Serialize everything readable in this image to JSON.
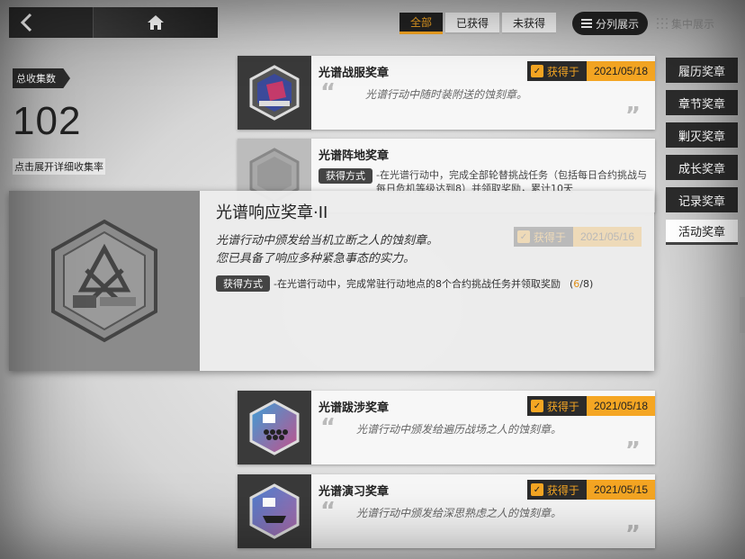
{
  "topbar": {
    "back": "‹",
    "home": "⌂"
  },
  "filters": [
    {
      "label": "全部",
      "active": true
    },
    {
      "label": "已获得",
      "active": false
    },
    {
      "label": "未获得",
      "active": false
    }
  ],
  "view": {
    "list_label": "分列展示",
    "focus_label": "集中展示"
  },
  "collection": {
    "tag": "总收集数",
    "count": "102",
    "hint": "点击展开详细收集率"
  },
  "categories": [
    {
      "label": "履历奖章"
    },
    {
      "label": "章节奖章"
    },
    {
      "label": "剿灭奖章"
    },
    {
      "label": "成长奖章"
    },
    {
      "label": "记录奖章"
    },
    {
      "label": "活动奖章"
    }
  ],
  "cards": [
    {
      "title": "光谱战服奖章",
      "desc": "光谱行动中随时装附送的蚀刻章。",
      "got_label": "获得于",
      "date": "2021/05/18"
    },
    {
      "title": "光谱阵地奖章",
      "obtain_label": "获得方式",
      "obtain_text": "-在光谱行动中，完成全部轮替挑战任务（包括每日合约挑战与每日危机等级达到8）并领取奖励，累计10天"
    },
    {
      "title": "光谱跋涉奖章",
      "desc": "光谱行动中颁发给遍历战场之人的蚀刻章。",
      "got_label": "获得于",
      "date": "2021/05/18"
    },
    {
      "title": "光谱演习奖章",
      "desc": "光谱行动中颁发给深思熟虑之人的蚀刻章。",
      "got_label": "获得于",
      "date": "2021/05/15"
    }
  ],
  "popup": {
    "title": "光谱响应奖章·II",
    "desc1": "光谱行动中颁发给当机立断之人的蚀刻章。",
    "desc2": "您已具备了响应多种紧急事态的实力。",
    "obtain_label": "获得方式",
    "obtain_text": "-在光谱行动中，完成常驻行动地点的8个合约挑战任务并领取奖励",
    "progress_cur": "6",
    "progress_total": "/8)",
    "progress_open": "(",
    "ghost_label": "获得于",
    "ghost_date": "2021/05/16"
  },
  "colors": {
    "accent": "#f5a623",
    "dark": "#2b2b2b"
  }
}
